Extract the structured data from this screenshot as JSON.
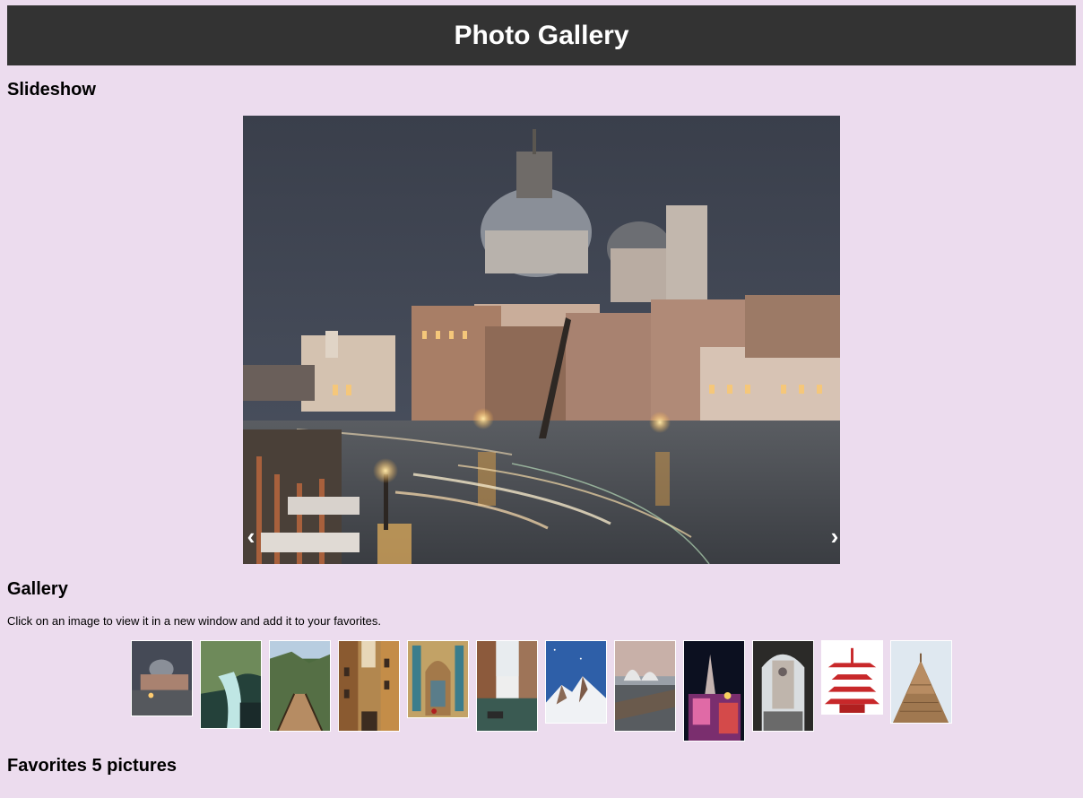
{
  "header": {
    "title": "Photo Gallery"
  },
  "slideshow": {
    "title": "Slideshow",
    "prev_label": "‹",
    "next_label": "›"
  },
  "gallery": {
    "title": "Gallery",
    "instructions": "Click on an image to view it in a new window and add it to your favorites."
  },
  "favorites": {
    "title": "Favorites 5 pictures"
  },
  "colors": {
    "background": "#ecdcee",
    "header": "#333333"
  }
}
